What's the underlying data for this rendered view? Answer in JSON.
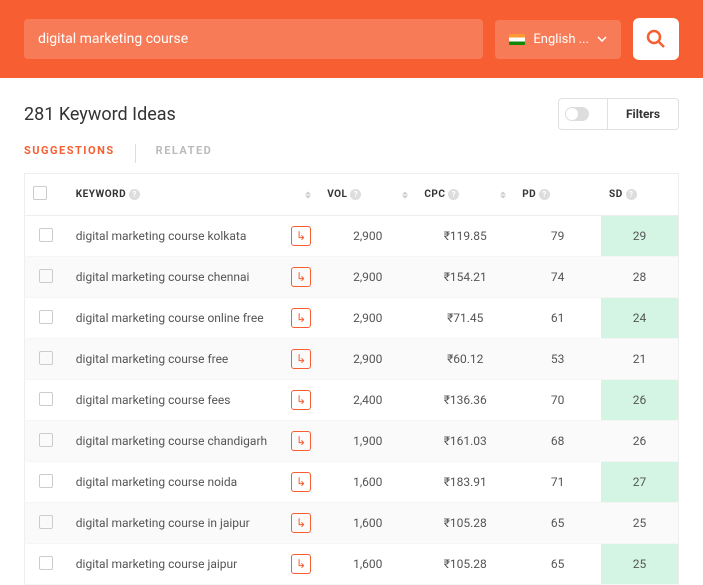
{
  "search": {
    "value": "digital marketing course",
    "lang": "English ...",
    "placeholder": ""
  },
  "title": "281 Keyword Ideas",
  "filters_label": "Filters",
  "tabs": {
    "suggestions": "SUGGESTIONS",
    "related": "RELATED"
  },
  "columns": {
    "keyword": "KEYWORD",
    "vol": "VOL",
    "cpc": "CPC",
    "pd": "PD",
    "sd": "SD"
  },
  "rows": [
    {
      "keyword": "digital marketing course kolkata",
      "vol": "2,900",
      "cpc": "₹119.85",
      "pd": "79",
      "sd": "29"
    },
    {
      "keyword": "digital marketing course chennai",
      "vol": "2,900",
      "cpc": "₹154.21",
      "pd": "74",
      "sd": "28"
    },
    {
      "keyword": "digital marketing course online free",
      "vol": "2,900",
      "cpc": "₹71.45",
      "pd": "61",
      "sd": "24"
    },
    {
      "keyword": "digital marketing course free",
      "vol": "2,900",
      "cpc": "₹60.12",
      "pd": "53",
      "sd": "21"
    },
    {
      "keyword": "digital marketing course fees",
      "vol": "2,400",
      "cpc": "₹136.36",
      "pd": "70",
      "sd": "26"
    },
    {
      "keyword": "digital marketing course chandigarh",
      "vol": "1,900",
      "cpc": "₹161.03",
      "pd": "68",
      "sd": "26"
    },
    {
      "keyword": "digital marketing course noida",
      "vol": "1,600",
      "cpc": "₹183.91",
      "pd": "71",
      "sd": "27"
    },
    {
      "keyword": "digital marketing course in jaipur",
      "vol": "1,600",
      "cpc": "₹105.28",
      "pd": "65",
      "sd": "25"
    },
    {
      "keyword": "digital marketing course jaipur",
      "vol": "1,600",
      "cpc": "₹105.28",
      "pd": "65",
      "sd": "25"
    }
  ]
}
